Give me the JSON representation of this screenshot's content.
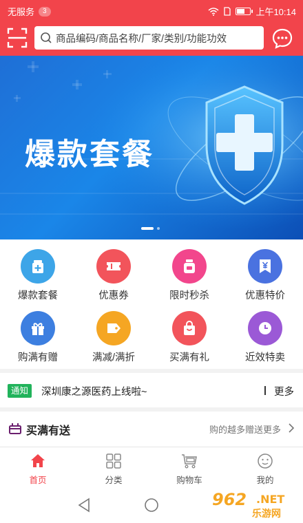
{
  "status_bar": {
    "carrier": "无服务",
    "notif_count": "3",
    "time": "上午10:14",
    "battery_level": 0.6
  },
  "search": {
    "placeholder": "商品编码/商品名称/厂家/类别/功能功效"
  },
  "banner": {
    "title": "爆款套餐",
    "slide_count": 2,
    "active_slide": 1
  },
  "categories": [
    {
      "label": "爆款套餐",
      "icon": "medicine-bottle-icon",
      "color": "#3da5e8"
    },
    {
      "label": "优惠券",
      "icon": "ticket-icon",
      "color": "#f2545b"
    },
    {
      "label": "限时秒杀",
      "icon": "jar-icon",
      "color": "#f2468c"
    },
    {
      "label": "优惠特价",
      "icon": "yen-tag-icon",
      "color": "#4a72e0"
    },
    {
      "label": "购满有赠",
      "icon": "gift-icon",
      "color": "#3d7fe0"
    },
    {
      "label": "满减/满折",
      "icon": "price-tag-icon",
      "color": "#f5a623"
    },
    {
      "label": "买满有礼",
      "icon": "shopping-bag-icon",
      "color": "#f2545b"
    },
    {
      "label": "近效特卖",
      "icon": "clock-icon",
      "color": "#9b59d6"
    }
  ],
  "notice": {
    "tag": "通知",
    "text": "深圳康之源医药上线啦~",
    "more": "更多"
  },
  "promo": {
    "title": "买满有送",
    "subtitle": "购的越多赠送更多"
  },
  "tabbar": {
    "items": [
      {
        "label": "首页",
        "icon": "home-icon"
      },
      {
        "label": "分类",
        "icon": "category-grid-icon"
      },
      {
        "label": "购物车",
        "icon": "cart-icon"
      },
      {
        "label": "我的",
        "icon": "profile-icon"
      }
    ],
    "active": 0
  },
  "colors": {
    "brand_red": "#f2444b",
    "notice_green": "#21b35b",
    "watermark_orange": "#f5a623"
  },
  "watermark": {
    "number": "962",
    "domain": ".NET",
    "chinese": "乐游网"
  }
}
